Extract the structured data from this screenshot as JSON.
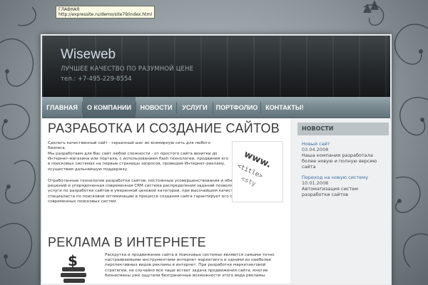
{
  "tooltip": {
    "line1": "ГЛАВНАЯ",
    "line2": "http://expressite.ru/demo/site79/index.html"
  },
  "header": {
    "logo": "Wiseweb",
    "slogan": "ЛУЧШЕЕ КАЧЕСТВО ПО РАЗУМНОЙ ЦЕНЕ",
    "phone": "тел.: +7-495-229-8554"
  },
  "nav": {
    "items": [
      {
        "label": "ГЛАВНАЯ"
      },
      {
        "label": "О КОМПАНИИ"
      },
      {
        "label": "НОВОСТИ"
      },
      {
        "label": "УСЛУГИ"
      },
      {
        "label": "ПОРТФОЛИО"
      },
      {
        "label": "КОНТАКТЫ!"
      }
    ]
  },
  "main": {
    "section1": {
      "title": "РАЗРАБОТКА И СОЗДАНИЕ САЙТОВ",
      "para1": "Сделать качественный сайт - серьезный шаг во всемирную сеть для любого бизнеса.",
      "para2": "Мы разработаем для Вас сайт любой сложности - от простого сайта визитки до Интернет-магазина или портала, с использованием flash технологии, продвинем его в поисковых системах на первые страницы запросов, проведем Интернет-рекламу, осуществим дальнейшую поддержку.",
      "para3": "Отработанные технологии разработки сайтов, постоянные усовершенствования и обновления программных решений и упорядоченная современная CRM система распределения заданий позволяют нам предоставлять услуги по разработке сайтов в умеренной ценовой категории, при высочайшем качестве работы. Участие специалиста по поисковой оптимизации в процессе создания сайта гарантирует его соответствие специфике современных поисковых систем."
    },
    "section2": {
      "title": "РЕКЛАМА В ИНТЕРНЕТЕ",
      "para1": "Раскрутка и продвижение сайта в поисковых системах являются самыми точно настраиваемыми инструментами интернет маркетинга и одними из наиболее перспективных видов рекламы в интернет. При разработке маркетинговой стратегии, не случайно все чаще встает задача продвижения сайта, многие бизнесмены уже ощутили безграничные возможности этого вида рекламы."
    }
  },
  "sidebar": {
    "title": "НОВОСТИ",
    "news": [
      {
        "title": "Новый сайт",
        "date": "03.04.2008",
        "text": "Наша компания разработала более новую и полную версию сайта"
      },
      {
        "title": "Переход на новую систему",
        "date": "10.01.2008",
        "text": "Автоматизация систем разработки сайтов"
      }
    ]
  },
  "image1": {
    "words": [
      "www.",
      "<title>",
      "<sty"
    ]
  },
  "colors": {
    "accent": "#3b6ea5",
    "nav": "#7a8b92",
    "header": "#25292b"
  }
}
